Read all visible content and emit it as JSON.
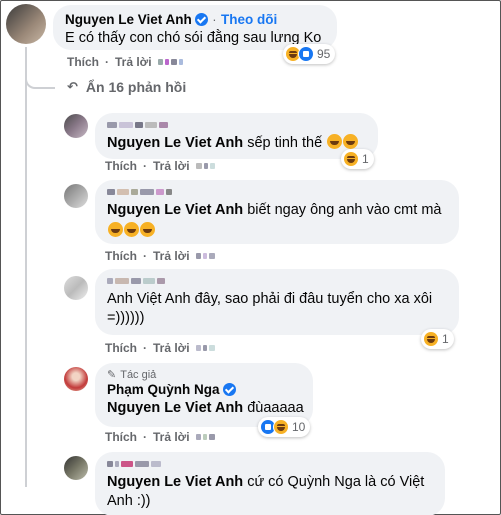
{
  "top_comment": {
    "author": "Nguyen Le Viet Anh",
    "dot": "·",
    "follow_label": "Theo dõi",
    "text": "E có thấy con chó sói đằng sau lưng Ko",
    "actions": {
      "like": "Thích",
      "dot": "·",
      "reply": "Trả lời"
    },
    "reaction_count": "95"
  },
  "more_replies_label": "Ẩn 16 phản hồi",
  "replies": [
    {
      "mention": "Nguyen Le Viet Anh",
      "text": " sếp tinh thế",
      "actions": {
        "like": "Thích",
        "dot": "·",
        "reply": "Trả lời"
      },
      "reaction_count": "1"
    },
    {
      "mention": "Nguyen Le Viet Anh",
      "text": " biết ngay ông anh vào cmt mà",
      "actions": {
        "like": "Thích",
        "dot": "·",
        "reply": "Trả lời"
      }
    },
    {
      "text_line1": "Anh Việt Anh đây, sao phải đi đâu tuyển cho xa xôi",
      "text_line2": "=))))))",
      "actions": {
        "like": "Thích",
        "dot": "·",
        "reply": "Trả lời"
      },
      "reaction_count": "1"
    },
    {
      "badge": "Tác giả",
      "author": "Phạm Quỳnh Nga",
      "mention": "Nguyen Le Viet Anh",
      "text": " đùaaaaa",
      "actions": {
        "like": "Thích",
        "dot": "·",
        "reply": "Trả lời"
      },
      "reaction_count": "10"
    },
    {
      "mention": "Nguyen Le Viet Anh",
      "text_line1": " cứ có Quỳnh Nga là có Việt",
      "text_line2": "Anh :))"
    }
  ]
}
